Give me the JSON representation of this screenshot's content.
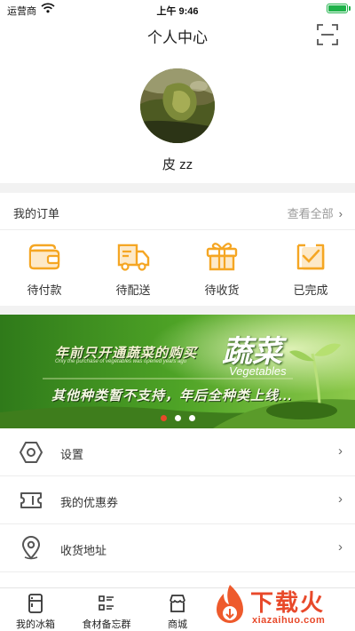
{
  "status_bar": {
    "carrier": "运营商",
    "time": "上午 9:46"
  },
  "header": {
    "title": "个人中心",
    "scan_icon": "scan-icon"
  },
  "profile": {
    "username": "皮 zz"
  },
  "orders": {
    "label": "我的订单",
    "view_all": "查看全部",
    "items": [
      {
        "label": "待付款",
        "icon": "wallet-icon"
      },
      {
        "label": "待配送",
        "icon": "delivery-truck-icon"
      },
      {
        "label": "待收货",
        "icon": "gift-box-icon"
      },
      {
        "label": "已完成",
        "icon": "checked-clipboard-icon"
      }
    ],
    "accent_color": "#f5a623"
  },
  "banner": {
    "line1": "年前只开通蔬菜的购买",
    "line1_sub": "Only the purchase of vegetables was opened years ago",
    "title": "蔬菜",
    "title_sub": "Vegetables",
    "line2": "其他种类暂不支持，年后全种类上线...",
    "slide_count": 3,
    "active_slide": 1,
    "active_dot_color": "#e8492a"
  },
  "menu": [
    {
      "label": "设置",
      "icon": "settings-hexagon-icon"
    },
    {
      "label": "我的优惠券",
      "icon": "coupon-icon"
    },
    {
      "label": "收货地址",
      "icon": "location-pin-icon"
    }
  ],
  "tabbar": [
    {
      "label": "我的冰箱",
      "icon": "fridge-icon"
    },
    {
      "label": "食材备忘群",
      "icon": "list-icon"
    },
    {
      "label": "商城",
      "icon": "store-icon"
    }
  ],
  "watermark": {
    "brand": "下载火",
    "url": "xiazaihuo.com"
  }
}
